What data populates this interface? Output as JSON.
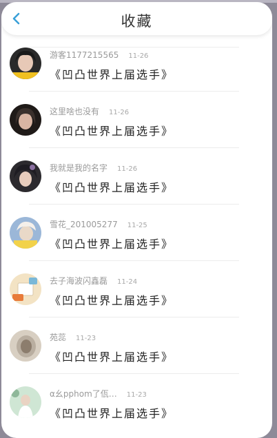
{
  "header": {
    "title": "收藏",
    "back_icon": "chevron-left-icon",
    "accent_color": "#3aa0d8"
  },
  "favorites": [
    {
      "author": "游客1177215565",
      "time": "11-26",
      "text": "《凹凸世界上届选手》",
      "avatar_colors": [
        "#2a2a2a",
        "#e7c9b7",
        "#f0c020"
      ]
    },
    {
      "author": "这里啥也没有",
      "time": "11-26",
      "text": "《凹凸世界上届选手》",
      "avatar_colors": [
        "#1f1a18",
        "#d9b5a3",
        "#3a302c"
      ]
    },
    {
      "author": "我就是我的名字",
      "time": "11-26",
      "text": "《凹凸世界上届选手》",
      "avatar_colors": [
        "#2c2a2e",
        "#e8cdbd",
        "#8a6fa0"
      ]
    },
    {
      "author": "雪花_201005277",
      "time": "11-25",
      "text": "《凹凸世界上届选手》",
      "avatar_colors": [
        "#9bb7d8",
        "#e9d9c8",
        "#f2d24a"
      ]
    },
    {
      "author": "去子海波闪鑫磊",
      "time": "11-24",
      "text": "《凹凸世界上届选手》",
      "avatar_colors": [
        "#f3e3c4",
        "#e87b3a",
        "#7ab8d8"
      ]
    },
    {
      "author": "苑蕊",
      "time": "11-23",
      "text": "《凹凸世界上届选手》",
      "avatar_colors": [
        "#b9aea0",
        "#8c7d6d",
        "#d8cfc2"
      ]
    },
    {
      "author": "α幺pphom了佤…",
      "time": "11-23",
      "text": "《凹凸世界上届选手》",
      "avatar_colors": [
        "#cfe6d4",
        "#e9d3c3",
        "#8fb89a"
      ]
    }
  ]
}
